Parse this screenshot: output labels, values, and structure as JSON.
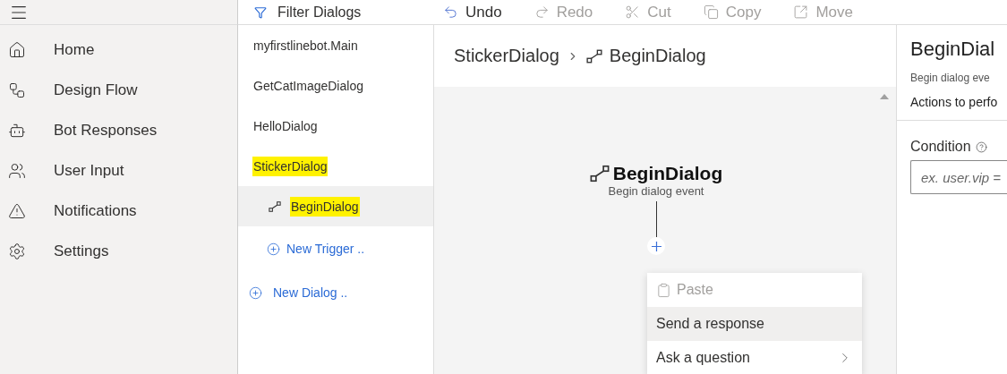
{
  "nav": {
    "items": [
      {
        "label": "Home"
      },
      {
        "label": "Design Flow"
      },
      {
        "label": "Bot Responses"
      },
      {
        "label": "User Input"
      },
      {
        "label": "Notifications"
      },
      {
        "label": "Settings"
      }
    ]
  },
  "dialog_list": {
    "filter_placeholder": "Filter Dialogs",
    "dialogs": [
      {
        "name": "myfirstlinebot.Main",
        "highlighted": false,
        "selected": false
      },
      {
        "name": "GetCatImageDialog",
        "highlighted": false,
        "selected": false
      },
      {
        "name": "HelloDialog",
        "highlighted": false,
        "selected": false
      },
      {
        "name": "StickerDialog",
        "highlighted": true,
        "selected": false,
        "children": [
          {
            "name": "BeginDialog",
            "highlighted": true,
            "selected": true
          }
        ],
        "new_trigger": "New Trigger .."
      }
    ],
    "new_dialog": "New Dialog .."
  },
  "toolbar": [
    {
      "label": "Undo",
      "disabled": false
    },
    {
      "label": "Redo",
      "disabled": true
    },
    {
      "label": "Cut",
      "disabled": true
    },
    {
      "label": "Copy",
      "disabled": true
    },
    {
      "label": "Move",
      "disabled": true
    }
  ],
  "breadcrumb": [
    {
      "label": "StickerDialog",
      "kind": "dialog"
    },
    {
      "label": "BeginDialog",
      "kind": "trigger"
    }
  ],
  "node": {
    "title": "BeginDialog",
    "subtitle": "Begin dialog event"
  },
  "menu": {
    "items": [
      {
        "label": "Paste",
        "disabled": true,
        "selected": false,
        "kind": "icon"
      },
      {
        "label": "Send a response",
        "disabled": false,
        "selected": true,
        "kind": "plain"
      },
      {
        "label": "Ask a question",
        "disabled": false,
        "selected": false,
        "kind": "submenu"
      }
    ]
  },
  "properties": {
    "title": "BeginDial",
    "description": "Begin dialog eve",
    "section": "Actions to perfo",
    "condition_label": "Condition",
    "condition_placeholder": "ex. user.vip ="
  }
}
